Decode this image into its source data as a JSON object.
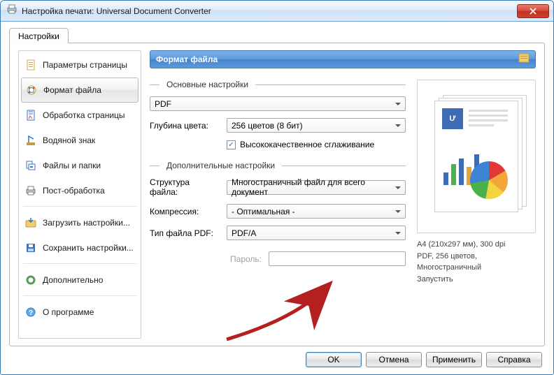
{
  "window": {
    "title": "Настройка печати: Universal Document Converter"
  },
  "tabs": {
    "settings": "Настройки"
  },
  "sidebar": {
    "items": [
      {
        "label": "Параметры страницы",
        "icon": "page-params-icon"
      },
      {
        "label": "Формат файла",
        "icon": "file-format-icon",
        "selected": true
      },
      {
        "label": "Обработка страницы",
        "icon": "page-process-icon"
      },
      {
        "label": "Водяной знак",
        "icon": "watermark-icon"
      },
      {
        "label": "Файлы и папки",
        "icon": "files-folders-icon"
      },
      {
        "label": "Пост-обработка",
        "icon": "post-process-icon"
      },
      {
        "label": "Загрузить настройки...",
        "icon": "load-icon"
      },
      {
        "label": "Сохранить настройки...",
        "icon": "save-icon"
      },
      {
        "label": "Дополнительно",
        "icon": "advanced-icon"
      },
      {
        "label": "О программе",
        "icon": "about-icon"
      }
    ]
  },
  "panel": {
    "title": "Формат файла",
    "groups": {
      "basic": "Основные настройки",
      "additional": "Дополнительные настройки"
    },
    "format_combo": "PDF",
    "color_depth_label": "Глубина цвета:",
    "color_depth_value": "256 цветов (8 бит)",
    "smoothing_checkbox": "Высококачественное сглаживание",
    "file_structure_label": "Структура файла:",
    "file_structure_value": "Многостраничный файл для всего документ",
    "compression_label": "Компрессия:",
    "compression_value": "- Оптимальная -",
    "pdf_type_label": "Тип файла PDF:",
    "pdf_type_value": "PDF/A",
    "password_label": "Пароль:",
    "password_value": ""
  },
  "preview": {
    "line1": "А4 (210x297 мм), 300 dpi",
    "line2": "PDF, 256 цветов, Многостраничный",
    "line3": "Запустить"
  },
  "buttons": {
    "ok": "OK",
    "cancel": "Отмена",
    "apply": "Применить",
    "help": "Справка"
  }
}
